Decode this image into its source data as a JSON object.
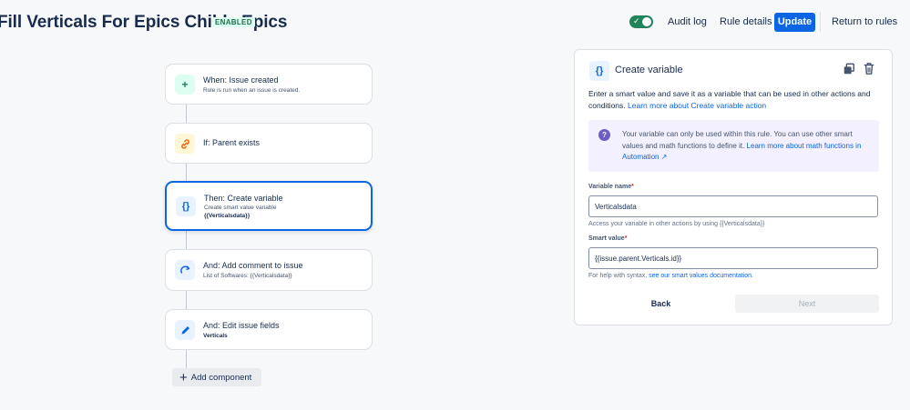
{
  "header": {
    "title": "Fill Verticals For Epics Childs Epics",
    "status_badge": "ENABLED",
    "audit_log": "Audit log",
    "rule_details": "Rule details",
    "update": "Update",
    "return_to_rules": "Return to rules",
    "toggle_on": true
  },
  "flow": {
    "steps": [
      {
        "title": "When: Issue created",
        "subtitle": "Rule is run when an issue is created.",
        "icon": "plus-icon"
      },
      {
        "title": "If: Parent exists",
        "icon": "link-icon"
      },
      {
        "title": "Then: Create variable",
        "subtitle": "Create smart value variable",
        "bold": "{{Verticalsdata}}",
        "icon": "braces-icon",
        "selected": true
      },
      {
        "title": "And: Add comment to issue",
        "subtitle": "List of Softwares: {{Verticalsdata}}",
        "icon": "comment-icon"
      },
      {
        "title": "And: Edit issue fields",
        "bold": "Verticals",
        "icon": "pencil-icon"
      }
    ],
    "add_component": "Add component"
  },
  "panel": {
    "title": "Create variable",
    "desc_text": "Enter a smart value and save it as a variable that can be used in other actions and conditions.",
    "desc_link": "Learn more about Create variable action",
    "info_text": "Your variable can only be used within this rule. You can use other smart values and math functions to define it.",
    "info_link": "Learn more about math functions in Automation ↗",
    "variable_name_label": "Variable name",
    "variable_name_value": "Verticalsdata",
    "variable_name_help": "Access your variable in other actions by using {{Verticalsdata}}",
    "smart_value_label": "Smart value",
    "smart_value_value": "{{issue.parent.Verticals.id}}",
    "smart_help_text": "For help with syntax,",
    "smart_help_link": "see our smart values documentation.",
    "back": "Back",
    "next": "Next"
  },
  "colors": {
    "primary": "#0c66e4",
    "enabled_badge_bg": "#dcfff1",
    "enabled_badge_text": "#216e4e",
    "toggle_on": "#1f845a",
    "info_bg": "#f3f0ff"
  }
}
